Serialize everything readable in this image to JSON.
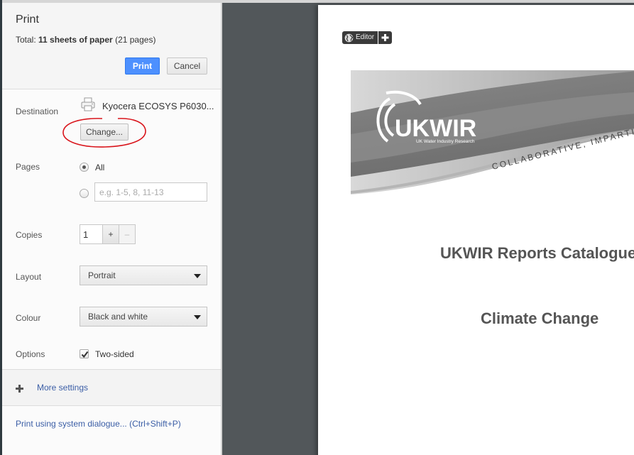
{
  "dialog": {
    "title": "Print",
    "summary_prefix": "Total: ",
    "summary_bold": "11 sheets of paper",
    "summary_suffix": " (21 pages)",
    "print_label": "Print",
    "cancel_label": "Cancel"
  },
  "destination": {
    "label": "Destination",
    "printer_name": "Kyocera ECOSYS P6030...",
    "change_label": "Change..."
  },
  "pages": {
    "label": "Pages",
    "all_label": "All",
    "all_selected": true,
    "custom_placeholder": "e.g. 1-5, 8, 11-13"
  },
  "copies": {
    "label": "Copies",
    "value": "1",
    "plus_label": "+",
    "minus_label": "–"
  },
  "layout": {
    "label": "Layout",
    "selected": "Portrait"
  },
  "colour": {
    "label": "Colour",
    "selected": "Black and white"
  },
  "options": {
    "label": "Options",
    "two_sided_label": "Two-sided",
    "two_sided_checked": true
  },
  "more_settings": {
    "label": "More settings"
  },
  "system_dialog": {
    "label": "Print using system dialogue... (Ctrl+Shift+P)"
  },
  "preview": {
    "editor_label": "Editor",
    "banner_logo": "UKWIR",
    "banner_logo_sub": "UK Water Industry Research",
    "banner_tagline": "COLLABORATIVE, IMPARTI",
    "doc_title": "UKWIR Reports Catalogue",
    "doc_subtitle": "Climate Change"
  },
  "colors": {
    "accent": "#4d90fe",
    "link": "#3b5ea6",
    "preview_bg": "#52575a",
    "annotation": "#d9141b"
  }
}
